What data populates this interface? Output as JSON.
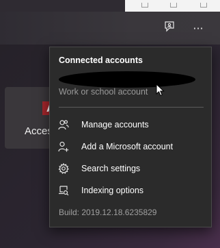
{
  "background": {
    "app_tile": {
      "badge": "A",
      "label": "Access"
    }
  },
  "header": {
    "feedback_icon": "feedback-icon",
    "more_label": "···"
  },
  "menu": {
    "heading": "Connected accounts",
    "account_type": "Work or school account",
    "items": [
      {
        "label": "Manage accounts",
        "icon": "manage-accounts-icon"
      },
      {
        "label": "Add a Microsoft account",
        "icon": "add-account-icon"
      },
      {
        "label": "Search settings",
        "icon": "gear-icon"
      },
      {
        "label": "Indexing options",
        "icon": "indexing-icon"
      }
    ],
    "build": "Build: 2019.12.18.6235829"
  },
  "colors": {
    "menu_background": "#2b2b2b",
    "badge_red": "#a4262c",
    "secondary_text": "#9a9a9a"
  }
}
